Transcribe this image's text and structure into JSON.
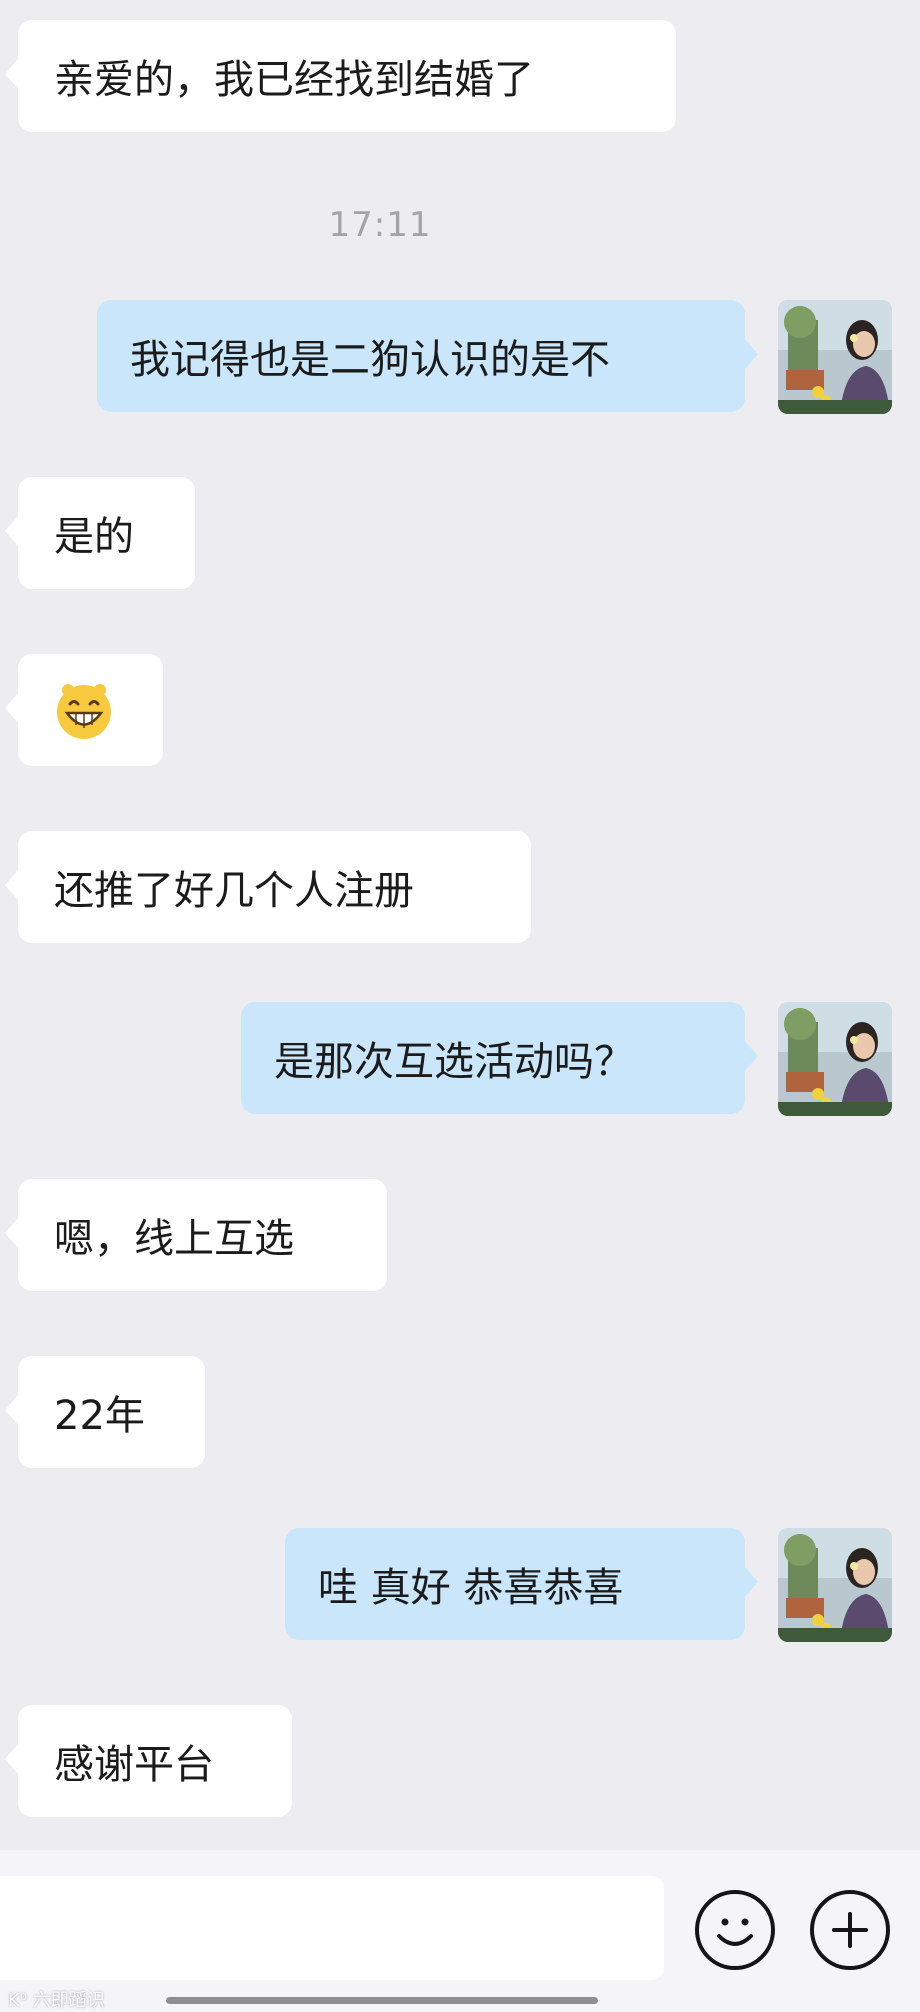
{
  "timestamp": "17:11",
  "messages": [
    {
      "side": "left",
      "text": "亲爱的，我已经找到结婚了"
    },
    {
      "side": "right",
      "text": "我记得也是二狗认识的是不"
    },
    {
      "side": "left",
      "text": "是的"
    },
    {
      "side": "left",
      "emoji": "grinning-face"
    },
    {
      "side": "left",
      "text": "还推了好几个人注册"
    },
    {
      "side": "right",
      "text": "是那次互选活动吗？"
    },
    {
      "side": "left",
      "text": "嗯，线上互选"
    },
    {
      "side": "left",
      "text": "22年"
    },
    {
      "side": "right",
      "text": "哇 真好 恭喜恭喜"
    },
    {
      "side": "left",
      "text": "感谢平台"
    }
  ],
  "input": {
    "placeholder": ""
  },
  "icons": {
    "emoji_button": "smiley-icon",
    "more_button": "plus-icon",
    "avatar": "user-avatar"
  },
  "watermark": "K⁰ 六即蹈识",
  "colors": {
    "background": "#ededf1",
    "incoming_bubble": "#ffffff",
    "outgoing_bubble": "#c9e6fb",
    "timestamp": "#a3a3a8"
  }
}
